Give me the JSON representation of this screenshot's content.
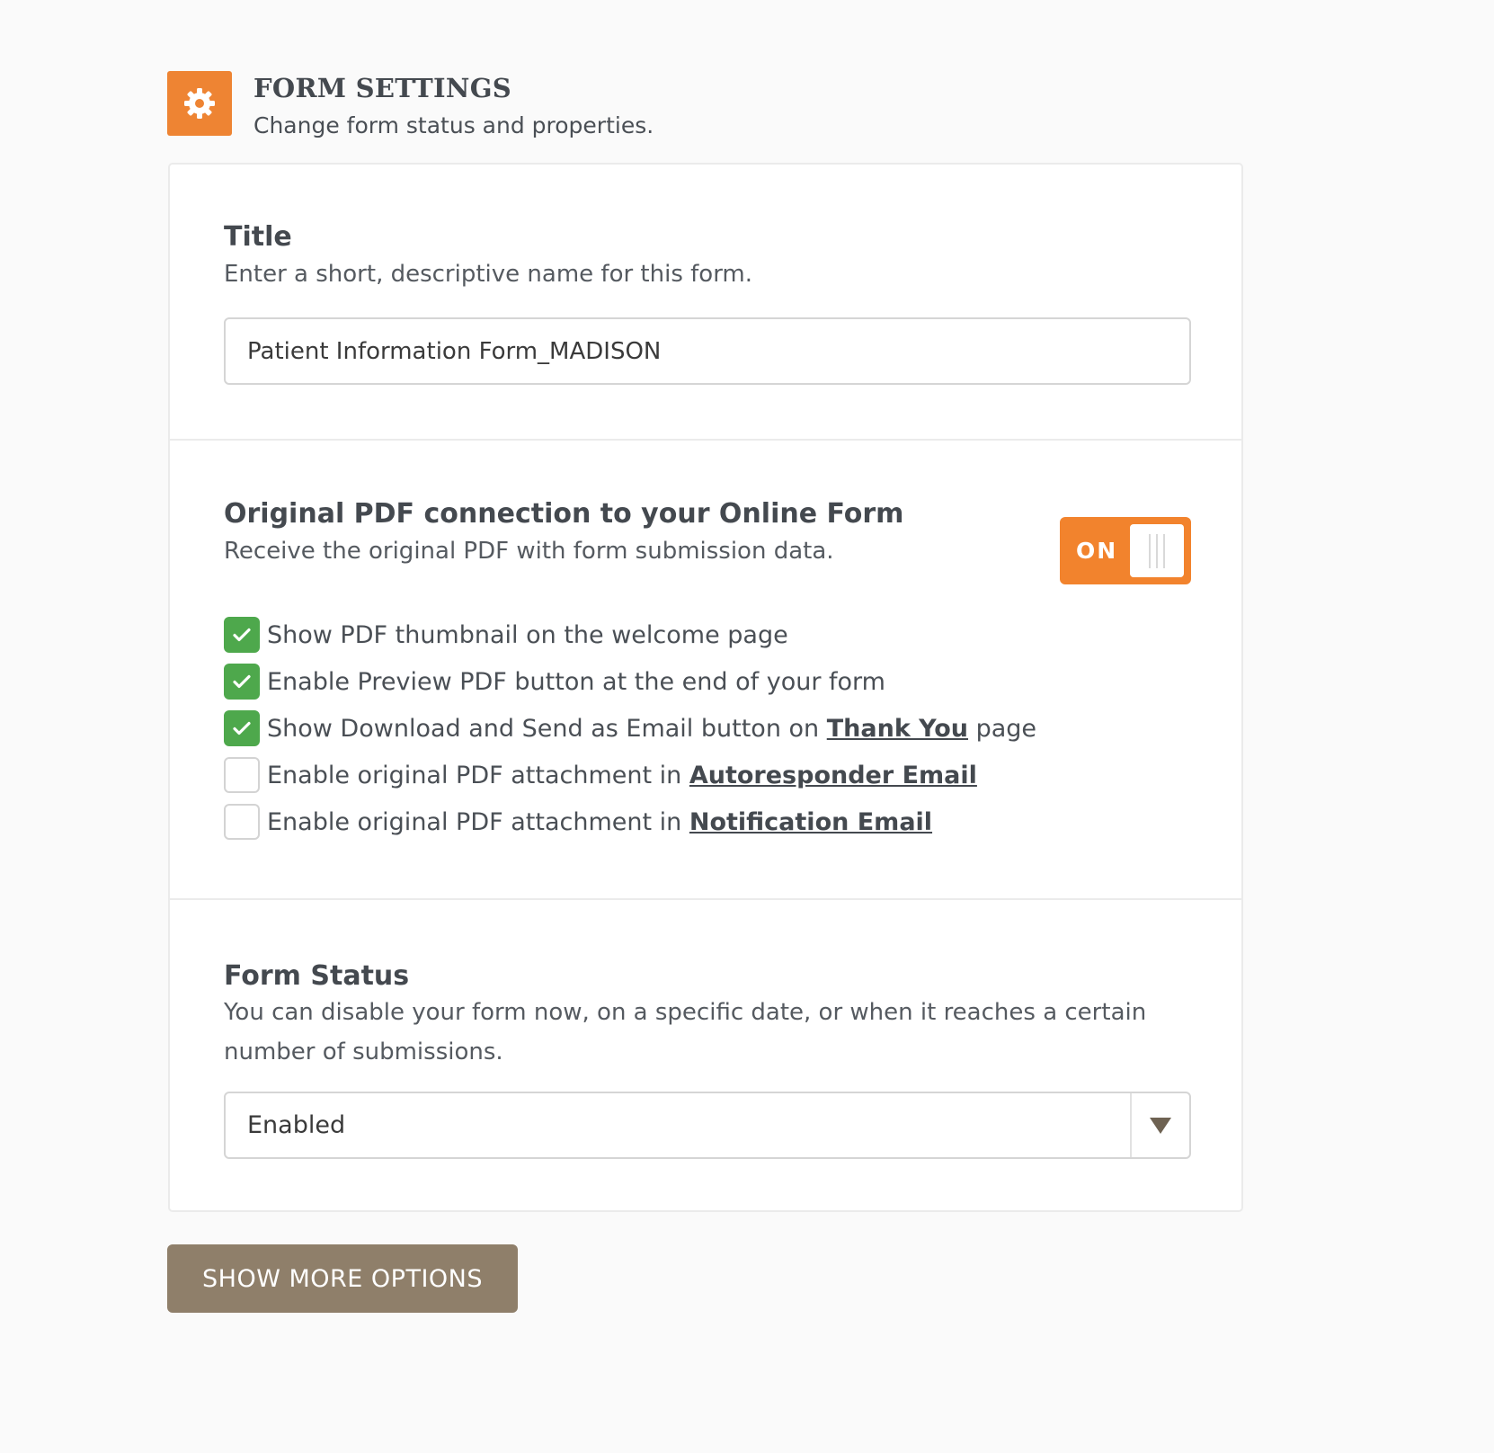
{
  "header": {
    "icon": "gear-icon",
    "title": "FORM SETTINGS",
    "subtitle": "Change form status and properties."
  },
  "title_section": {
    "heading": "Title",
    "description": "Enter a short, descriptive name for this form.",
    "input_value": "Patient Information Form_MADISON"
  },
  "pdf_section": {
    "heading": "Original PDF connection to your Online Form",
    "description": "Receive the original PDF with form submission data.",
    "toggle_label": "ON",
    "toggle_on": true,
    "options": [
      {
        "text": "Show PDF thumbnail on the welcome page",
        "checked": true
      },
      {
        "text": "Enable Preview PDF button at the end of your form",
        "checked": true
      },
      {
        "text_before": "Show Download and Send as Email button on ",
        "link": "Thank You",
        "text_after": " page",
        "checked": true
      },
      {
        "text_before": "Enable original PDF attachment in ",
        "link": "Autoresponder Email",
        "checked": false
      },
      {
        "text_before": "Enable original PDF attachment in ",
        "link": "Notification Email",
        "checked": false
      }
    ]
  },
  "status_section": {
    "heading": "Form Status",
    "description": "You can disable your form now, on a specific date, or when it reaches a certain number of submissions.",
    "selected": "Enabled"
  },
  "more_button": "SHOW MORE OPTIONS",
  "colors": {
    "accent": "#ee8433",
    "check": "#4ea84c",
    "button": "#8f7f6a"
  }
}
